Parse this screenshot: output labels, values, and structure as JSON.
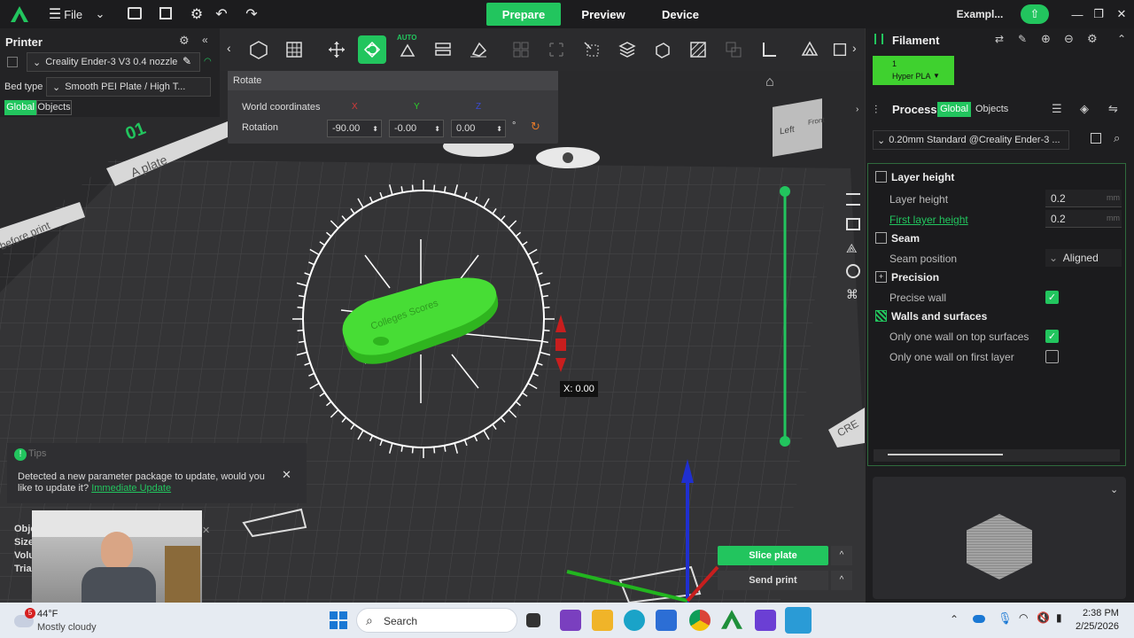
{
  "topbar": {
    "file_label": "File",
    "tabs": [
      "Prepare",
      "Preview",
      "Device"
    ],
    "project_name": "Exampl..."
  },
  "left": {
    "printer_title": "Printer",
    "printer_select": "Creality Ender-3 V3 0.4 nozzle",
    "bed_type_label": "Bed type",
    "bed_type_value": "Smooth PEI Plate / High T...",
    "scope_tabs": [
      "Global",
      "Objects"
    ]
  },
  "rotate": {
    "title": "Rotate",
    "world_coords_label": "World coordinates",
    "axes": [
      "X",
      "Y",
      "Z"
    ],
    "rotation_label": "Rotation",
    "values": [
      "-90.00",
      "-0.00",
      "0.00"
    ],
    "unit": "°"
  },
  "viewport": {
    "plate_number": "01",
    "plate_name": "A plate",
    "side_text": "before print",
    "nav_cube_left": "Left",
    "nav_cube_front": "Front",
    "x_readout": "X: 0.00",
    "edge_text": "CRE"
  },
  "tips": {
    "title": "Tips",
    "message": "Detected a new parameter package to update, would you like to update it?",
    "link": "Immediate Update"
  },
  "object_info": [
    "Obje",
    "Size",
    "Volu",
    "Tria"
  ],
  "bottom_buttons": {
    "slice": "Slice plate",
    "send": "Send print"
  },
  "right": {
    "filament_title": "Filament",
    "filament_slot_number": "1",
    "filament_name": "Hyper PLA",
    "process_title": "Process",
    "process_tabs": [
      "Global",
      "Objects"
    ],
    "process_preset": "0.20mm Standard @Creality Ender-3 ...",
    "sections": {
      "layer_height": {
        "title": "Layer height",
        "layer_height_label": "Layer height",
        "layer_height_value": "0.2",
        "first_layer_label": "First layer height",
        "first_layer_value": "0.2",
        "unit": "mm"
      },
      "seam": {
        "title": "Seam",
        "position_label": "Seam position",
        "position_value": "Aligned"
      },
      "precision": {
        "title": "Precision",
        "precise_wall_label": "Precise wall"
      },
      "walls": {
        "title": "Walls and surfaces",
        "top_label": "Only one wall on top surfaces",
        "first_label": "Only one wall on first layer"
      }
    }
  },
  "taskbar": {
    "weather_temp": "44°F",
    "weather_desc": "Mostly cloudy",
    "weather_badge": "5",
    "search_label": "Search",
    "time": "2:38 PM",
    "date": "2/25/2026"
  },
  "colors": {
    "accent": "#22c55e",
    "panel_dark": "#1e1e20",
    "model_green": "#3fd12f",
    "taskbar": "#e6ebf2"
  }
}
